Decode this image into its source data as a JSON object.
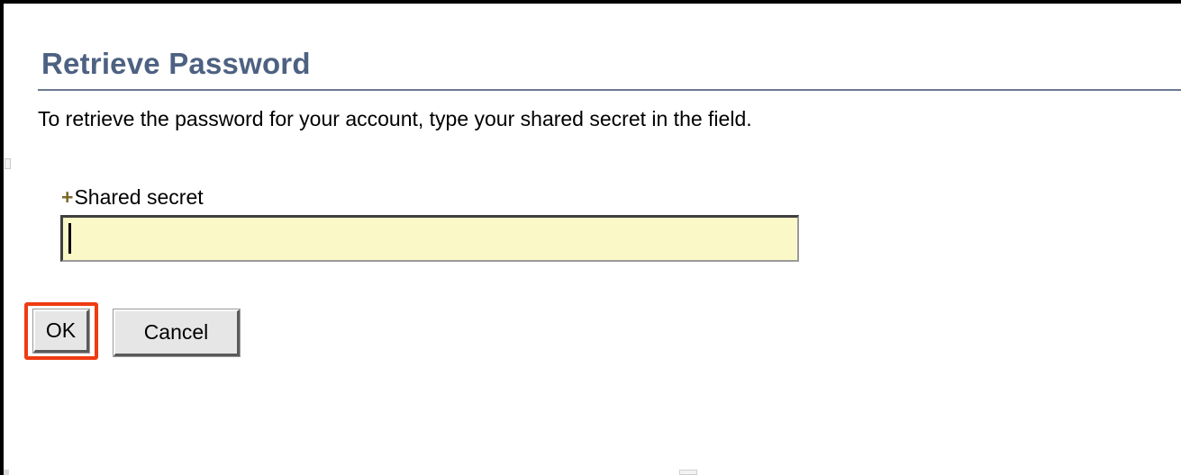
{
  "dialog": {
    "title": "Retrieve Password",
    "description": "To retrieve the password for your account, type your shared secret in the field."
  },
  "form": {
    "required_marker": "+",
    "shared_secret_label": "Shared secret",
    "shared_secret_value": ""
  },
  "buttons": {
    "ok_label": "OK",
    "cancel_label": "Cancel"
  },
  "colors": {
    "title": "#4d6182",
    "input_background": "#fbf8c8",
    "highlight": "#ef3b12"
  }
}
